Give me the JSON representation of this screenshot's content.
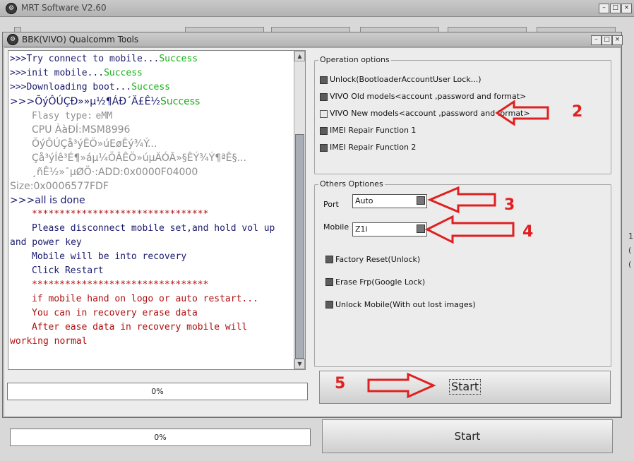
{
  "outer_window": {
    "title": "MRT Software V2.60"
  },
  "inner_window": {
    "title": "BBK(VIVO) Qualcomm Tools"
  },
  "log": {
    "lines": [
      {
        "a": ">>>Try connect to mobile...",
        "b": "Success"
      },
      {
        "a": ">>>init mobile...",
        "b": "Success"
      },
      {
        "a": ">>>Downloading boot...",
        "b": "Success"
      },
      {
        "a": ">>>ÕýÔÚÇÐ»»µ½¶ÁÐ´Ä£Ê½",
        "b": "Success"
      },
      {
        "a": "Flasy type:",
        "b": "eMM"
      },
      {
        "a": "CPU  ÀàÐÍ:",
        "b": "MSM8996"
      },
      {
        "a": "ÕýÔÚÇå³ýÊÖ»úEøÊý¾Ý..."
      },
      {
        "a": "Çå³ýÍê³É¶»áµ¼ÖÂÊÖ»úµÄÓÃ»§ÊÝ¾Ý¶ªÊ§..."
      },
      {
        "a": "¸ñÊ½»¯µØÖ·:ADD:0x0000F04000"
      },
      {
        "a": "Size:0x0006577FDF"
      },
      {
        "a": ">>>all is done"
      },
      {
        "a": "********************************"
      },
      {
        "a": "Please disconnect mobile set,and hold vol up"
      },
      {
        "a": "and power key"
      },
      {
        "a": "Mobile will be into recovery"
      },
      {
        "a": "Click Restart"
      },
      {
        "a": "********************************"
      },
      {
        "a": "if mobile hand on logo or auto restart..."
      },
      {
        "a": "You can in recovery erase data"
      },
      {
        "a": "After ease data in recovery mobile will"
      },
      {
        "a": "working normal"
      }
    ]
  },
  "progress_inner": "0%",
  "progress_outer": "0%",
  "operation_options": {
    "title": "Operation options",
    "items": [
      "Unlock(BootloaderAccountUser Lock...)",
      "VIVO Old models<account ,password and format>",
      "VIVO New models<account ,password and format>",
      "IMEI Repair Function 1",
      "IMEI Repair Function 2"
    ]
  },
  "others_options": {
    "title": "Others Optiones",
    "port_label": "Port",
    "port_value": "Auto",
    "mobile_label": "Mobile",
    "mobile_value": "Z1i",
    "checks": [
      "Factory Reset(Unlock)",
      "Erase Frp(Google Lock)",
      "Unlock Mobile(With out lost images)"
    ]
  },
  "start_inner": "Start",
  "start_outer": "Start",
  "annotations": {
    "n2": "2",
    "n3": "3",
    "n4": "4",
    "n5": "5"
  },
  "colors": {
    "annotation": "#e02020",
    "success": "#19b019",
    "error_text": "#b01010"
  }
}
